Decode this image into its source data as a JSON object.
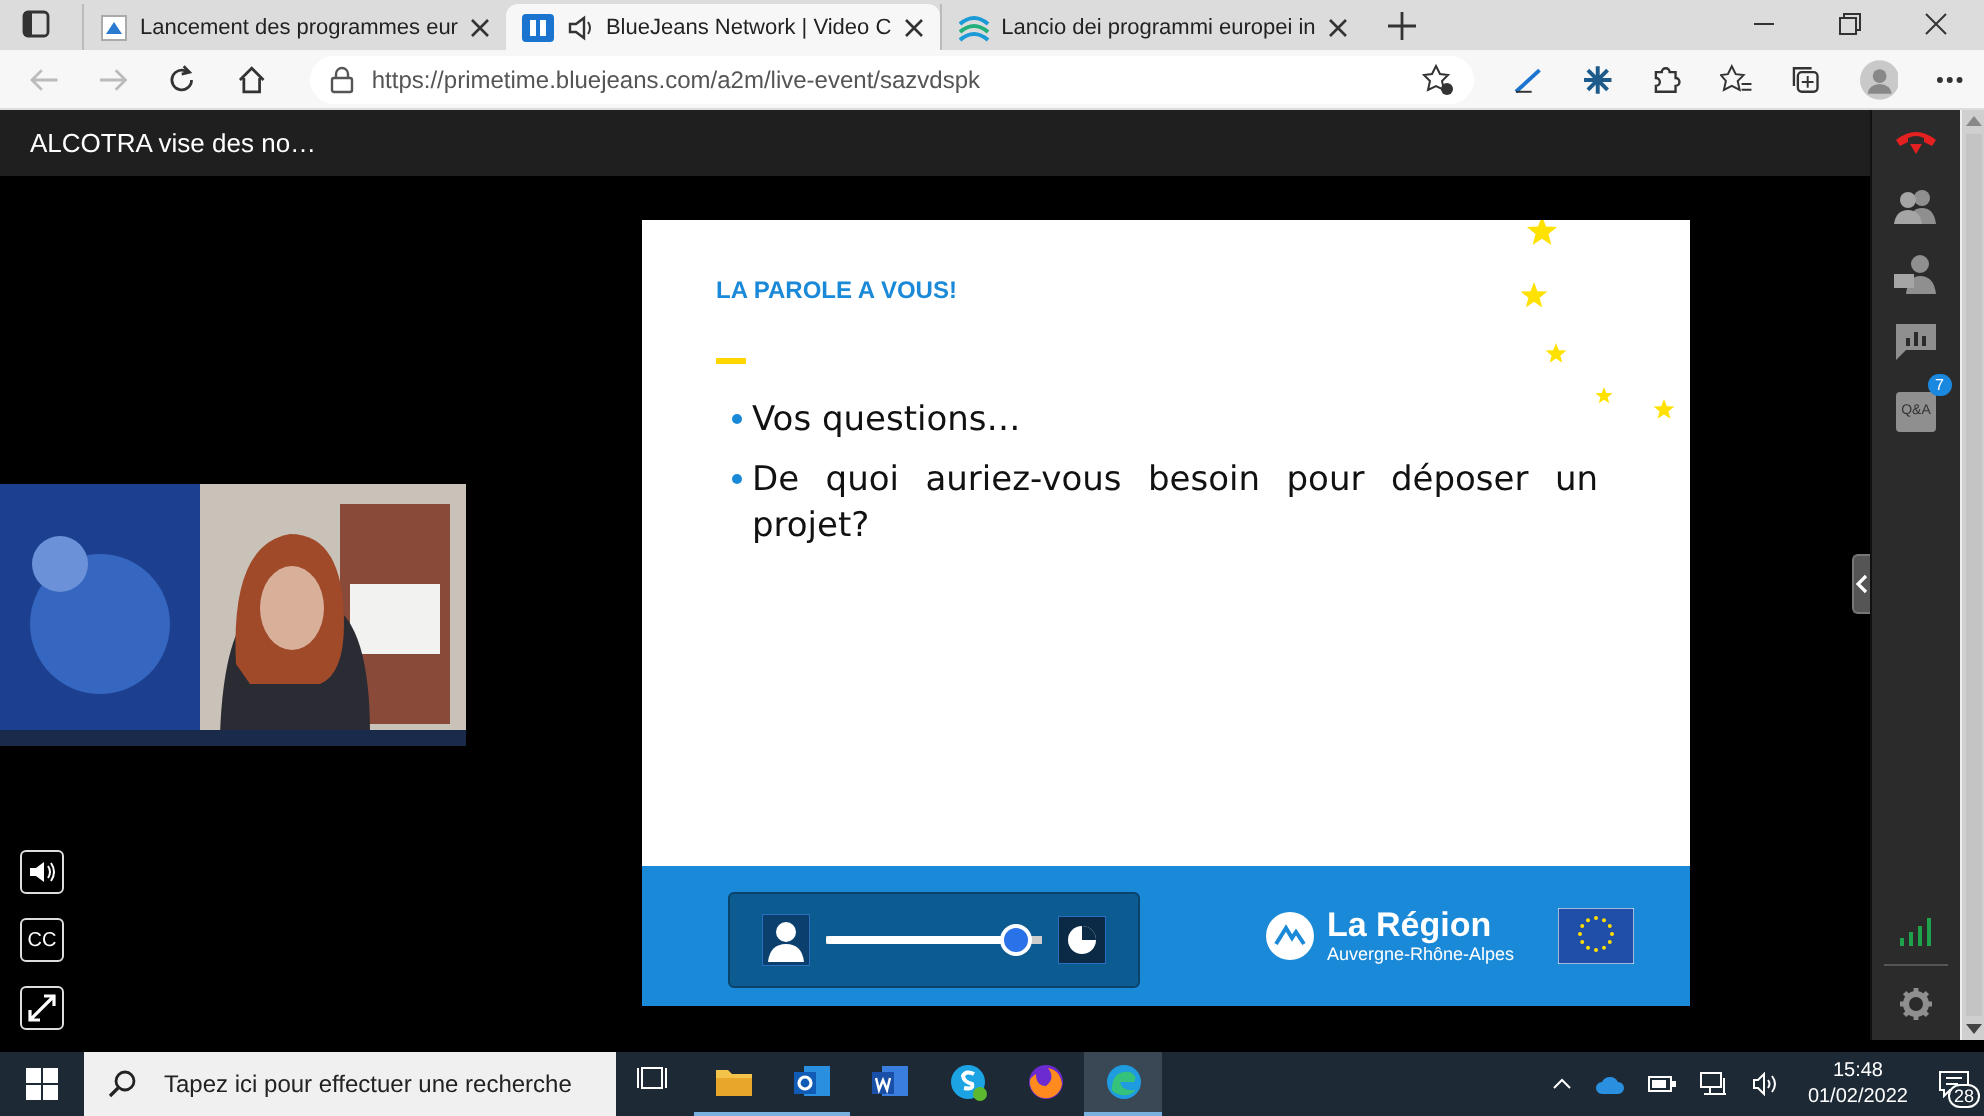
{
  "browser": {
    "tabs": [
      {
        "title": "Lancement des programmes eur",
        "selected": false,
        "kind": "doc"
      },
      {
        "title": "BlueJeans Network | Video C",
        "selected": true,
        "kind": "bj"
      },
      {
        "title": "Lancio dei programmi europei in",
        "selected": false,
        "kind": "wave"
      }
    ],
    "url": "https://primetime.bluejeans.com/a2m/live-event/sazvdspk"
  },
  "event": {
    "title": "ALCOTRA vise des no…"
  },
  "slide": {
    "heading": "LA PAROLE A VOUS!",
    "bullets": [
      "Vos questions…",
      "De quoi auriez-vous besoin pour déposer un projet?"
    ],
    "brand": "La Région",
    "brand_sub": "Auvergne-Rhône-Alpes"
  },
  "volume": {
    "level": 0.88
  },
  "controls": [
    {
      "kind": "volume"
    },
    {
      "kind": "cc",
      "label": "CC"
    },
    {
      "kind": "fullscreen"
    }
  ],
  "sidebar": {
    "qa_label": "Q&A",
    "qa_badge": "7"
  },
  "taskbar": {
    "search_placeholder": "Tapez ici pour effectuer une recherche",
    "time": "15:48",
    "date": "01/02/2022",
    "notifications": "28"
  }
}
